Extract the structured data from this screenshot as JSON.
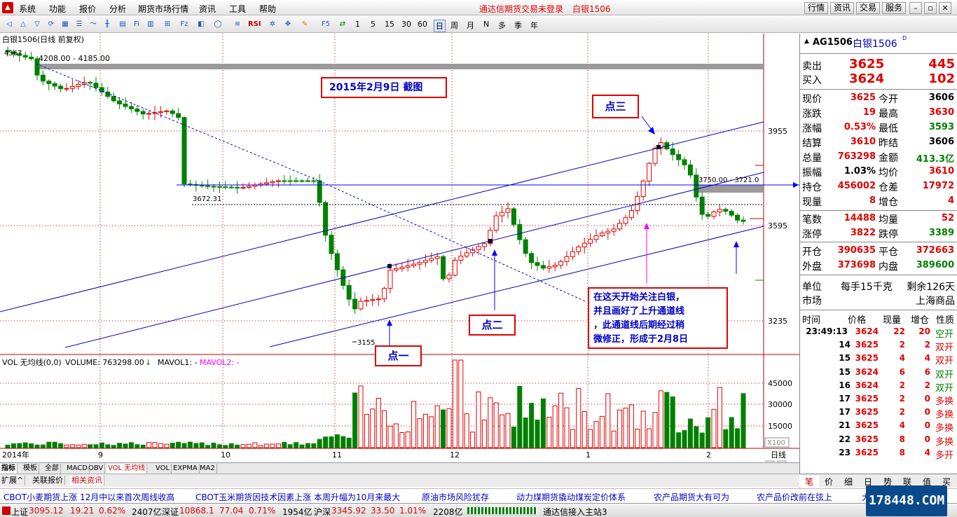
{
  "menu": {
    "items": [
      "系统",
      "功能",
      "报价",
      "分析",
      "期货市场行情",
      "资讯",
      "工具",
      "帮助"
    ],
    "title_notice": "通达信期货交易未登录",
    "title_symbol": "白银1506",
    "buttons": [
      "行情",
      "资讯",
      "交易",
      "服务"
    ],
    "window_controls": [
      "minimize",
      "restore",
      "close"
    ]
  },
  "toolbar": {
    "periods": [
      "1",
      "5",
      "15",
      "30",
      "60",
      "日",
      "周",
      "月",
      "N",
      "多",
      "季",
      "年"
    ],
    "selected_period": "日",
    "icon_names": [
      "back-icon",
      "up-icon",
      "down-icon",
      "refresh-icon",
      "quote-icon",
      "list-icon",
      "tick-icon",
      "minute-icon",
      "kline-icon",
      "f10-icon",
      "fund-icon",
      "compare-icon",
      "f10b-icon",
      "fiz-icon",
      "draw-icon",
      "circle-icon",
      "indicator-icon",
      "rsi-icon",
      "move-icon",
      "pen-icon",
      "formula-icon",
      "switch-icon"
    ]
  },
  "chart": {
    "header": "白银1506(日线 前复权)",
    "top_marker": "4367",
    "label_high_zone": "4208.00 - 4185.00",
    "label_mid_line": "3672.31",
    "label_right_zone": "3750.00 - 3721.0",
    "label_low": "3155",
    "y_ticks": [
      "3955",
      "3595",
      "3235"
    ],
    "x_labels": [
      "2014年",
      "9",
      "10",
      "11",
      "12",
      "1",
      "2",
      "日线"
    ],
    "annotations": {
      "date_note": "2015年2月9日  截图",
      "point1": "点一",
      "point2": "点二",
      "point3": "点三",
      "comment_lines": [
        "在这天开始关注白银，",
        "并且画好了上升通道线",
        "，此通道线后期经过稍",
        "微修正，形成于2月8日"
      ]
    }
  },
  "volume": {
    "header_name": "VOL 无均线(0,0)",
    "header_volume": "VOLUME: 763298.00",
    "header_mavol1": "MAVOL1: -",
    "header_mavol2": "MAVOL2: -",
    "y_ticks": [
      "45000",
      "30000",
      "15000"
    ],
    "unit": "X100"
  },
  "bottom_tabs": [
    "指标",
    "模板",
    "全部",
    "MACD",
    "OBV",
    "VOL 无均线",
    "VOL",
    "EXPMA",
    "MA2"
  ],
  "bottom_tabs2": [
    "扩展^",
    "关联报价",
    "相关资讯"
  ],
  "right_panel": {
    "code": "AG1506",
    "name": "白银1506",
    "suffix": "D",
    "sell_label": "卖出",
    "sell_price": "3625",
    "sell_vol": "445",
    "buy_label": "买入",
    "buy_price": "3624",
    "buy_vol": "102",
    "rows": [
      {
        "l1": "现价",
        "v1": "3625",
        "c1": "red",
        "l2": "今开",
        "v2": "3606",
        "c2": "blk"
      },
      {
        "l1": "涨跌",
        "v1": "19",
        "c1": "red",
        "l2": "最高",
        "v2": "3630",
        "c2": "red"
      },
      {
        "l1": "涨幅",
        "v1": "0.53%",
        "c1": "red",
        "l2": "最低",
        "v2": "3593",
        "c2": "grn"
      },
      {
        "l1": "结算",
        "v1": "3610",
        "c1": "red",
        "l2": "昨结",
        "v2": "3606",
        "c2": "blk"
      },
      {
        "l1": "总量",
        "v1": "763298",
        "c1": "red",
        "l2": "金额",
        "v2": "413.3亿",
        "c2": "grn"
      },
      {
        "l1": "振幅",
        "v1": "1.03%",
        "c1": "blk",
        "l2": "均价",
        "v2": "3610",
        "c2": "red"
      },
      {
        "l1": "持仓",
        "v1": "456002",
        "c1": "red",
        "l2": "仓差",
        "v2": "17972",
        "c2": "red"
      },
      {
        "l1": "现量",
        "v1": "8",
        "c1": "red",
        "l2": "增仓",
        "v2": "4",
        "c2": "red"
      }
    ],
    "rows2": [
      {
        "l1": "笔数",
        "v1": "14488",
        "c1": "red",
        "l2": "均量",
        "v2": "52",
        "c2": "red"
      },
      {
        "l1": "涨停",
        "v1": "3822",
        "c1": "red",
        "l2": "跌停",
        "v2": "3389",
        "c2": "grn"
      }
    ],
    "rows3": [
      {
        "l1": "开仓",
        "v1": "390635",
        "c1": "red",
        "l2": "平仓",
        "v2": "372663",
        "c2": "red"
      },
      {
        "l1": "外盘",
        "v1": "373698",
        "c1": "red",
        "l2": "内盘",
        "v2": "389600",
        "c2": "grn"
      }
    ],
    "unit_label": "单位",
    "unit_value": "每手15千克",
    "remain": "剩余126天",
    "market_label": "市场",
    "market_value": "上海商品",
    "tick_headers": [
      "时间",
      "价格",
      "现量",
      "增仓",
      "性质"
    ],
    "ticks": [
      {
        "t": "23:49:13",
        "p": "3624",
        "v": "22",
        "z": "20",
        "x": "空开",
        "xc": "grn"
      },
      {
        "t": "14",
        "p": "3625",
        "v": "2",
        "z": "2",
        "x": "双开",
        "xc": "red"
      },
      {
        "t": "15",
        "p": "3625",
        "v": "4",
        "z": "4",
        "x": "双开",
        "xc": "red"
      },
      {
        "t": "15",
        "p": "3624",
        "v": "6",
        "z": "6",
        "x": "双开",
        "xc": "grn"
      },
      {
        "t": "16",
        "p": "3624",
        "v": "2",
        "z": "2",
        "x": "双开",
        "xc": "grn"
      },
      {
        "t": "17",
        "p": "3625",
        "v": "2",
        "z": "0",
        "x": "多换",
        "xc": "red"
      },
      {
        "t": "17",
        "p": "3625",
        "v": "2",
        "z": "0",
        "x": "多换",
        "xc": "red"
      },
      {
        "t": "21",
        "p": "3625",
        "v": "4",
        "z": "0",
        "x": "多换",
        "xc": "red"
      },
      {
        "t": "22",
        "p": "3625",
        "v": "8",
        "z": "0",
        "x": "多换",
        "xc": "red"
      },
      {
        "t": "23",
        "p": "3625",
        "v": "8",
        "z": "4",
        "x": "多开",
        "xc": "red"
      }
    ],
    "tabs": [
      "笔",
      "价",
      "细",
      "日",
      "势",
      "联",
      "值",
      "买"
    ]
  },
  "news": [
    "CBOT小麦期货上涨  12月中以来首次周线收高",
    "CBOT玉米期货因技术因素上涨  本周升幅为10月来最大",
    "原油市场风险犹存",
    "动力煤期货撬动煤炭定价体系",
    "农产品期货大有可为",
    "农产品价改前在弦上",
    "大"
  ],
  "status": {
    "sh_label": "上证",
    "sh_val": "3095.12",
    "sh_chg": "19.21",
    "sh_pct": "0.62%",
    "sh_amt": "2407亿",
    "sz_label": "深证",
    "sz_val": "10868.1",
    "sz_chg": "77.04",
    "sz_pct": "0.71%",
    "sz_amt": "1954亿",
    "hs_label": "沪深",
    "hs_val": "3345.92",
    "hs_chg": "33.50",
    "hs_pct": "1.01%",
    "hs_amt": "2208亿",
    "server": "通达信接入主站3",
    "watermark": "178448.COM"
  },
  "colors": {
    "up": "#e00000",
    "down": "#008000",
    "channel": "#0000d0",
    "accent": "#0000c0",
    "grid": "#c00000"
  }
}
